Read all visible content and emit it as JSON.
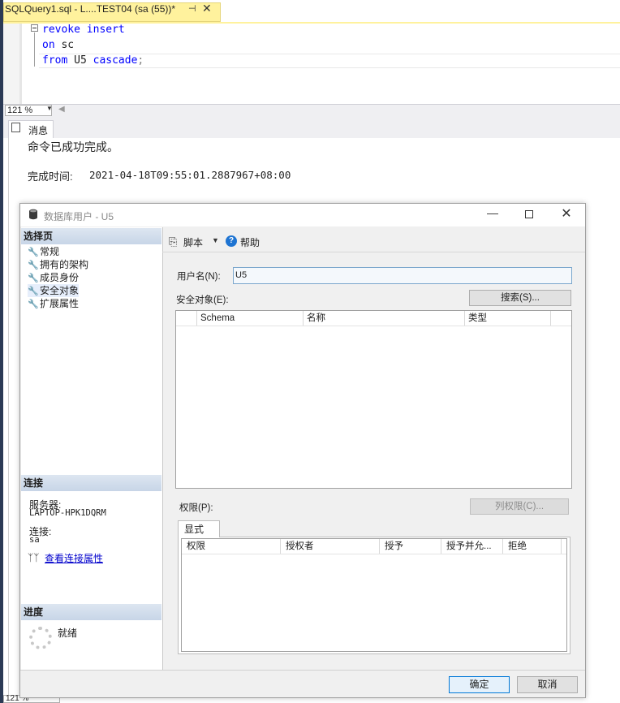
{
  "editor": {
    "tab_title": "SQLQuery1.sql - L....TEST04 (sa (55))*",
    "pin_glyph": "⊣",
    "close_glyph": "✕",
    "code": {
      "line1_kw1": "revoke",
      "line1_kw2": "insert",
      "line2_kw": "on",
      "line2_name": "sc",
      "line3_kw": "from",
      "line3_name": "U5",
      "line3_kw2": "cascade",
      "line3_semicolon": ";"
    },
    "zoom": "121 %",
    "bottom_zoom": "121 %"
  },
  "results": {
    "tab_label": "消息",
    "message": "命令已成功完成。",
    "completion_label": "完成时间:",
    "completion_time": "2021-04-18T09:55:01.2887967+08:00"
  },
  "dialog": {
    "title": "数据库用户 - U5",
    "min_glyph": "—",
    "close_glyph": "✕",
    "select_page_header": "选择页",
    "pages": [
      {
        "label": "常规"
      },
      {
        "label": "拥有的架构"
      },
      {
        "label": "成员身份"
      },
      {
        "label": "安全对象"
      },
      {
        "label": "扩展属性"
      }
    ],
    "connection_header": "连接",
    "server_label": "服务器:",
    "server_value": "LAPTOP-HPK1DQRM",
    "connection_label": "连接:",
    "connection_value": "sa",
    "view_connection_link": "查看连接属性",
    "progress_header": "进度",
    "progress_status": "就绪",
    "toolbar": {
      "script_label": "脚本",
      "help_label": "帮助"
    },
    "username_label": "用户名(N):",
    "username_value": "U5",
    "securables_label": "安全对象(E):",
    "search_button": "搜索(S)...",
    "securables_columns": [
      "Schema",
      "名称",
      "类型"
    ],
    "permissions_label": "权限(P):",
    "column_permissions_button": "列权限(C)...",
    "explicit_tab": "显式",
    "permissions_columns": [
      "权限",
      "授权者",
      "授予",
      "授予并允...",
      "拒绝"
    ],
    "ok_button": "确定",
    "cancel_button": "取消"
  },
  "colors": {
    "tab_yellow": "#fff29d",
    "keyword_blue": "#0000ff",
    "link_blue": "#0000cc",
    "ok_border": "#0078d7"
  }
}
